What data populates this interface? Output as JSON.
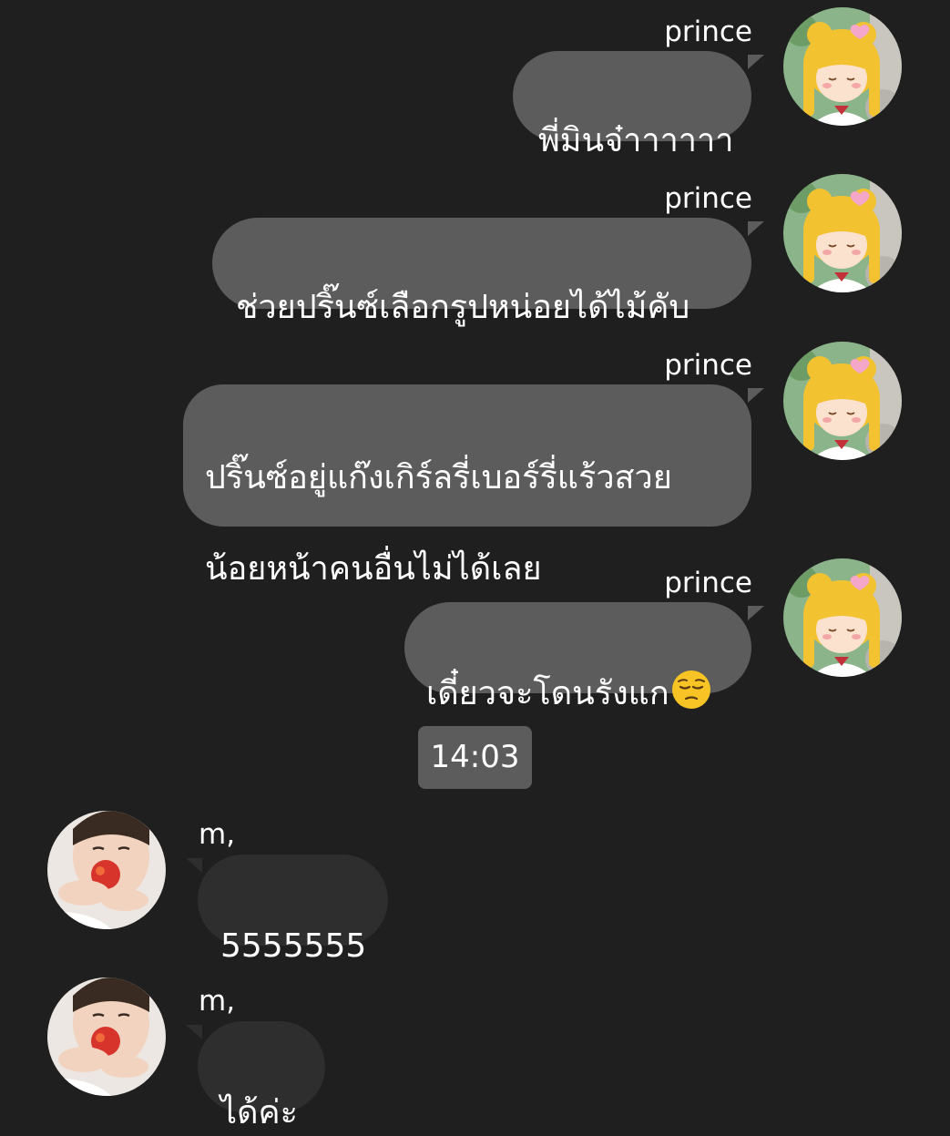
{
  "conversation": {
    "timestamp": "14:03",
    "messages": [
      {
        "sender": "prince",
        "text": "พี่มินจ๋าาาาาา"
      },
      {
        "sender": "prince",
        "text": "ช่วยปริ๊นซ์เลือกรูปหน่อยได้ไม้คับ"
      },
      {
        "sender": "prince",
        "text_line1": "ปริ๊นซ์อยู่แก๊งเกิร์ลรี่เบอร์รี่แร้วสวย",
        "text_line2": "น้อยหน้าคนอื่นไม่ได้เลย"
      },
      {
        "sender": "prince",
        "text": "เดี๋ยวจะโดนรังแก",
        "emoji": "pensive-face"
      },
      {
        "sender": "m,",
        "text": "5555555"
      },
      {
        "sender": "m,",
        "text": "ได้ค่ะ"
      }
    ]
  },
  "colors": {
    "background": "#1f1f1f",
    "outgoing_bubble": "#5c5c5c",
    "incoming_bubble": "#2e2e2e",
    "timestamp_bg": "#5c5c5c"
  },
  "icons": {
    "prince_avatar": "anime-girl-avatar",
    "m_avatar": "person-photo-avatar"
  }
}
